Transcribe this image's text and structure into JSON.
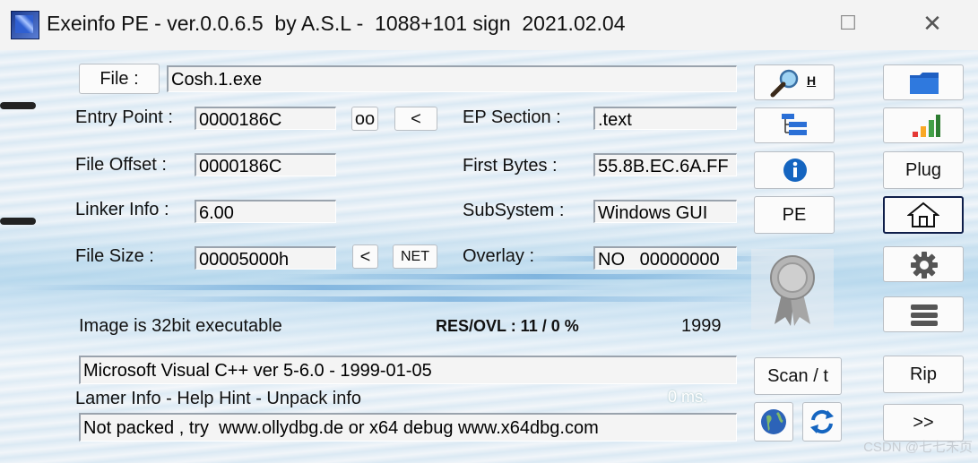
{
  "titlebar": {
    "title": "Exeinfo PE - ver.0.0.6.5  by A.S.L -  1088+101 sign  2021.02.04",
    "maximize": "☐",
    "close": "✕"
  },
  "file": {
    "button": "File :",
    "value": "Cosh.1.exe"
  },
  "entry_point": {
    "label": "Entry Point :",
    "value": "0000186C",
    "oo": "oo",
    "lt": "<"
  },
  "ep_section": {
    "label": "EP Section :",
    "value": ".text"
  },
  "file_offset": {
    "label": "File Offset :",
    "value": "0000186C"
  },
  "first_bytes": {
    "label": "First Bytes :",
    "value": "55.8B.EC.6A.FF"
  },
  "linker": {
    "label": "Linker Info :",
    "value": "6.00"
  },
  "subsystem": {
    "label": "SubSystem :",
    "value": "Windows GUI"
  },
  "file_size": {
    "label": "File Size :",
    "value": "00005000h",
    "lt": "<",
    "net": "NET"
  },
  "overlay": {
    "label": "Overlay :",
    "value": "NO   00000000"
  },
  "info": {
    "image": "Image is 32bit executable",
    "res_ovl": "RES/OVL : 11 / 0 %",
    "year": "1999"
  },
  "detect": {
    "value": "Microsoft Visual C++ ver 5-6.0 - 1999-01-05"
  },
  "hint": {
    "label": "Lamer Info - Help Hint - Unpack info",
    "time": "0 ms."
  },
  "advice": {
    "value": "Not packed , try  www.ollydbg.de or x64 debug www.x64dbg.com"
  },
  "mid_buttons": {
    "search_h": "H",
    "pe": "PE",
    "scan": "Scan / t"
  },
  "right_buttons": {
    "plug": "Plug",
    "rip": "Rip",
    "next": ">>"
  },
  "watermark": "CSDN @七七禾页",
  "colors": {
    "accent": "#1e63c8",
    "window_bg": "#eef3f8"
  }
}
